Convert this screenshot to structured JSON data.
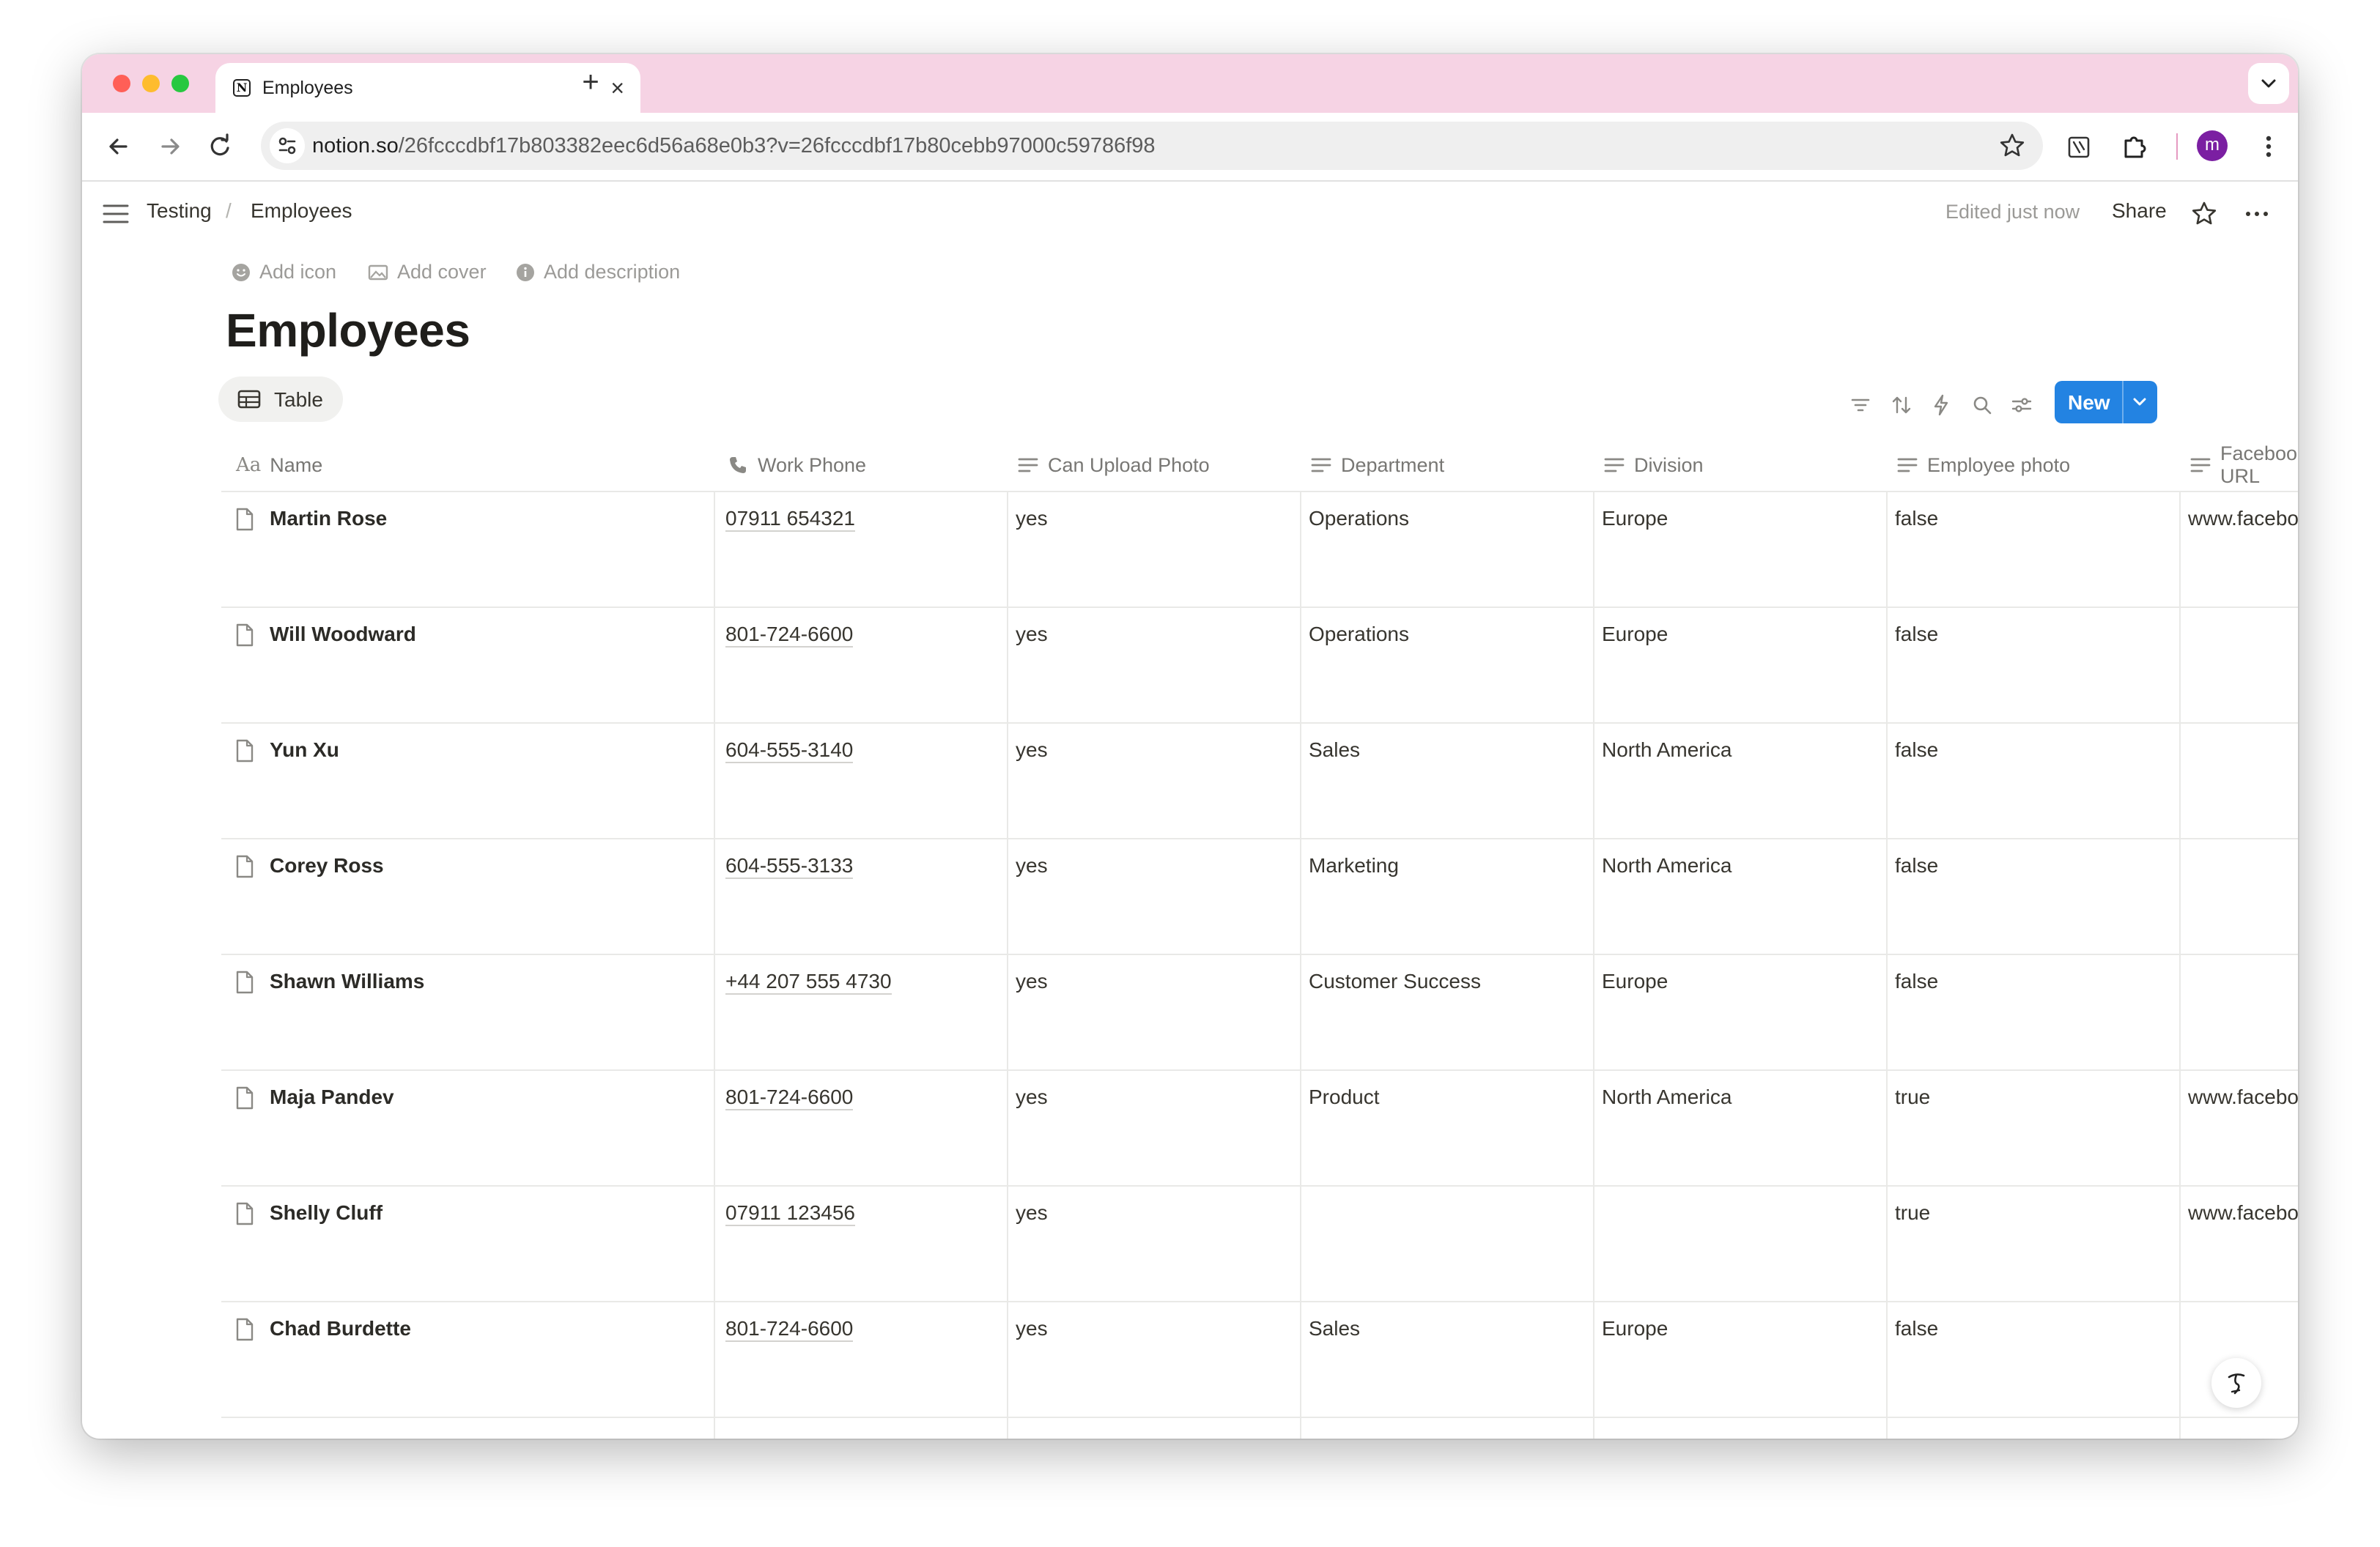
{
  "browser": {
    "tab_title": "Employees",
    "url_host": "notion.so",
    "url_path": "/26fcccdbf17b803382eec6d56a68e0b3?v=26fcccdbf17b80cebb97000c59786f98",
    "profile_initial": "m",
    "accent": "#f6d3e4"
  },
  "topbar": {
    "breadcrumb": [
      "Testing",
      "Employees"
    ],
    "edited": "Edited just now",
    "share_label": "Share"
  },
  "page": {
    "actions": [
      "Add icon",
      "Add cover",
      "Add description"
    ],
    "title": "Employees",
    "view_label": "Table",
    "new_label": "New",
    "new_color": "#2383e2"
  },
  "table": {
    "columns": [
      "Name",
      "Work Phone",
      "Can Upload Photo",
      "Department",
      "Division",
      "Employee photo",
      "Facebook URL"
    ],
    "rows": [
      {
        "name": "Martin Rose",
        "phone": "07911 654321",
        "upload": "yes",
        "department": "Operations",
        "division": "Europe",
        "photo": "false",
        "facebook": "www.facebook.com"
      },
      {
        "name": "Will Woodward",
        "phone": "801-724-6600",
        "upload": "yes",
        "department": "Operations",
        "division": "Europe",
        "photo": "false",
        "facebook": ""
      },
      {
        "name": "Yun Xu",
        "phone": "604-555-3140",
        "upload": "yes",
        "department": "Sales",
        "division": "North America",
        "photo": "false",
        "facebook": ""
      },
      {
        "name": "Corey Ross",
        "phone": "604-555-3133",
        "upload": "yes",
        "department": "Marketing",
        "division": "North America",
        "photo": "false",
        "facebook": ""
      },
      {
        "name": "Shawn Williams",
        "phone": "+44 207 555 4730",
        "upload": "yes",
        "department": "Customer Success",
        "division": "Europe",
        "photo": "false",
        "facebook": ""
      },
      {
        "name": "Maja Pandev",
        "phone": "801-724-6600",
        "upload": "yes",
        "department": "Product",
        "division": "North America",
        "photo": "true",
        "facebook": "www.facebook.com"
      },
      {
        "name": "Shelly Cluff",
        "phone": "07911 123456",
        "upload": "yes",
        "department": "",
        "division": "",
        "photo": "true",
        "facebook": "www.facebook.com"
      },
      {
        "name": "Chad Burdette",
        "phone": "801-724-6600",
        "upload": "yes",
        "department": "Sales",
        "division": "Europe",
        "photo": "false",
        "facebook": ""
      }
    ]
  }
}
